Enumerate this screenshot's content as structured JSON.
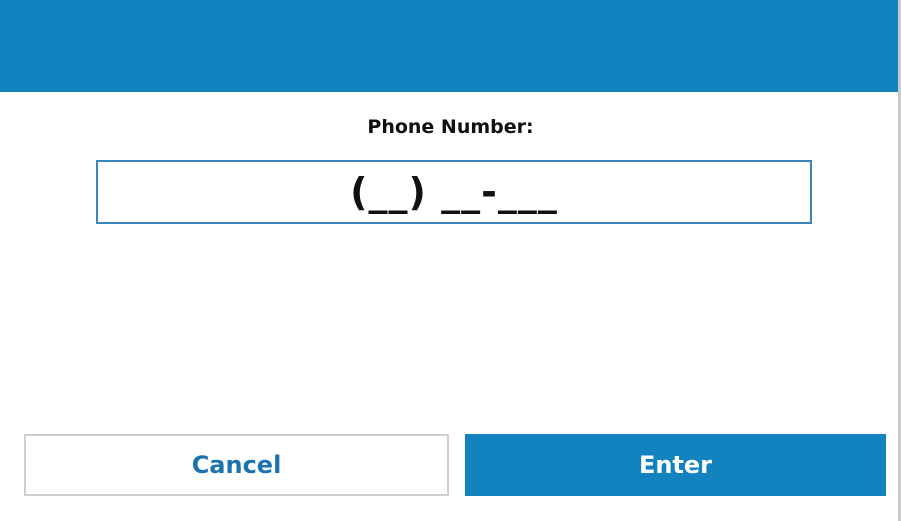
{
  "dialog": {
    "field_label": "Phone Number:",
    "phone_value": "(__) __-___"
  },
  "buttons": {
    "cancel_label": "Cancel",
    "enter_label": "Enter"
  },
  "colors": {
    "accent": "#1383bf",
    "input_border": "#3a86b8",
    "cancel_text": "#1a73b0"
  }
}
